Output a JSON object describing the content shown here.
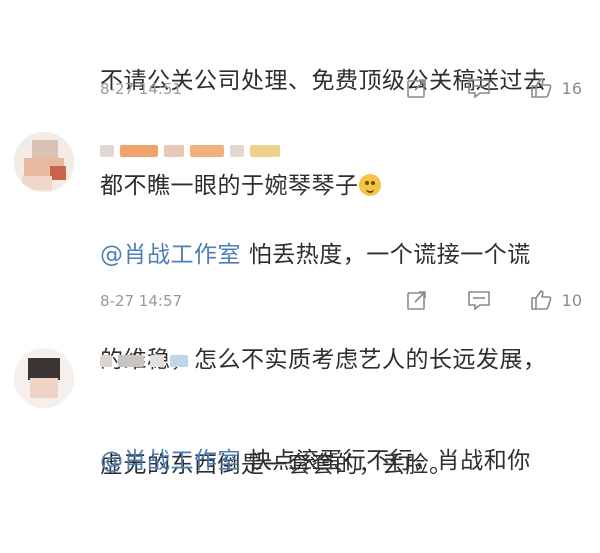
{
  "comments": [
    {
      "text_lines": [
        "不请公关公司处理、免费顶级公关稿送过去",
        "都不瞧一眼的于婉琴琴子"
      ],
      "emoji": "grinning-emoji",
      "time": "8-27 14:51",
      "likes": "16"
    },
    {
      "mention": "@肖战工作室",
      "text_lines": [
        " 怕丢热度，一个谎接一个谎",
        "的维稳，怎么不实质考虑艺人的长远发展，",
        "虚无的东西倒是一套套的，丢脸。"
      ],
      "time": "8-27 14:57",
      "likes": "10"
    },
    {
      "mention": "@肖战工作室",
      "text_lines": [
        " 快点滚蛋行不行，肖战和你"
      ]
    }
  ],
  "icons": {
    "share": "share-icon",
    "comment": "comment-icon",
    "like": "thumbs-up-icon"
  },
  "colors": {
    "mention": "#4d7fb5",
    "meta": "#9a9a9a",
    "text": "#2e2e2e"
  }
}
